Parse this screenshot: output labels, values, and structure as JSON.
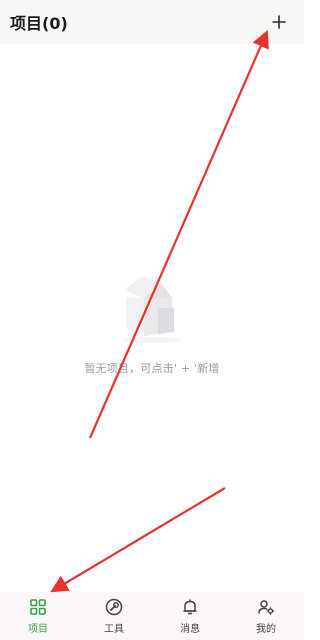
{
  "header": {
    "title": "项目(0)",
    "add_icon": "plus-icon"
  },
  "empty_state": {
    "illustration": "empty-house-illustration",
    "message": "暂无项目，可点击' + '新增"
  },
  "tabbar": {
    "tabs": [
      {
        "label": "项目",
        "icon": "grid-icon",
        "active": true
      },
      {
        "label": "工具",
        "icon": "wrench-icon",
        "active": false
      },
      {
        "label": "消息",
        "icon": "bell-icon",
        "active": false
      },
      {
        "label": "我的",
        "icon": "user-settings-icon",
        "active": false
      }
    ]
  },
  "colors": {
    "accent": "#3aa14b",
    "header_bg": "#f6f8f6",
    "tabbar_bg": "#fbf7fb",
    "annotation": "#e8322b"
  }
}
